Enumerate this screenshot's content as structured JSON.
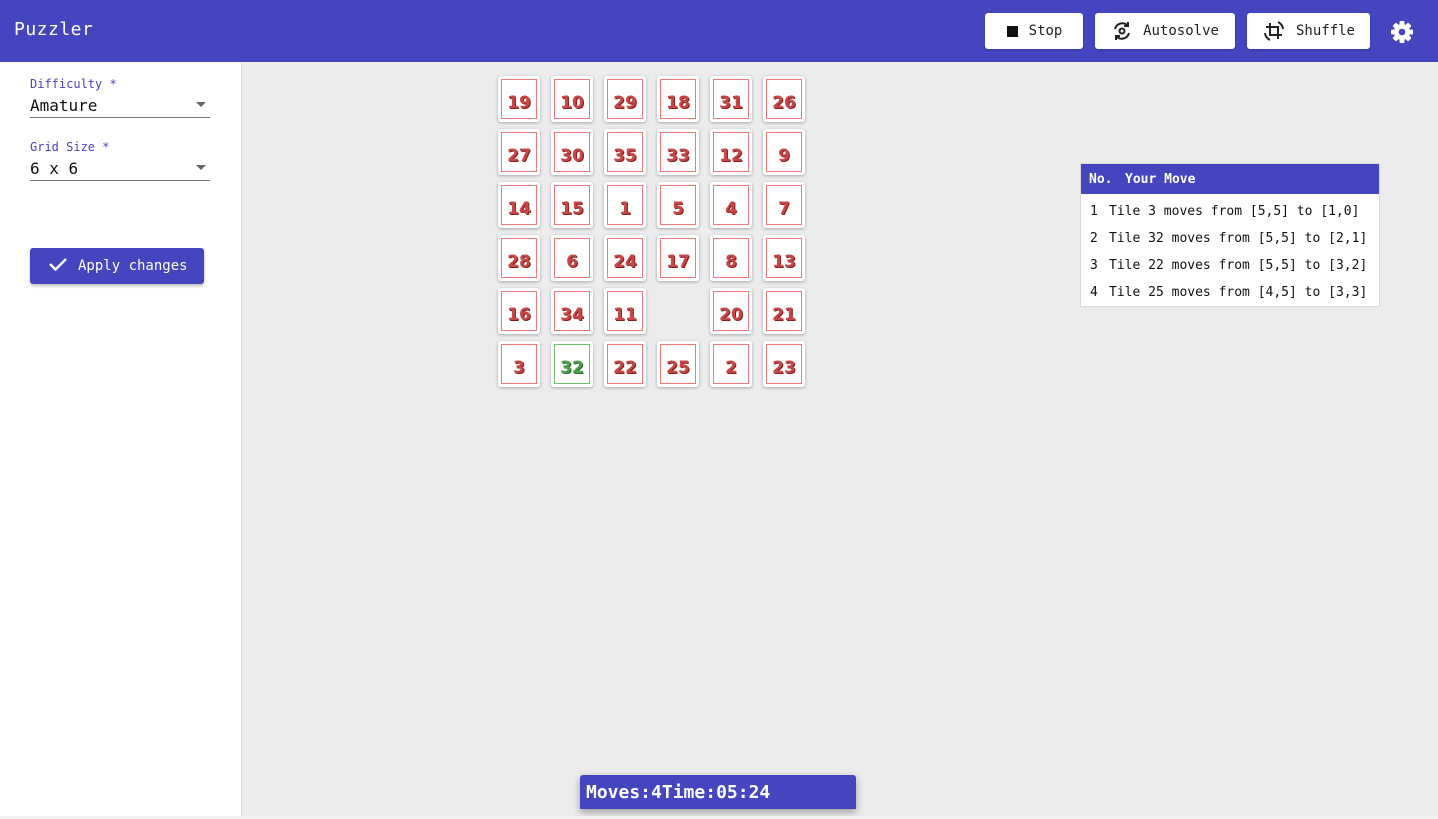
{
  "app": {
    "title": "Puzzler"
  },
  "toolbar": {
    "stop_label": "Stop",
    "autosolve_label": "Autosolve",
    "shuffle_label": "Shuffle"
  },
  "sidebar": {
    "difficulty": {
      "label": "Difficulty *",
      "value": "Amature"
    },
    "grid_size": {
      "label": "Grid Size *",
      "value": "6 x 6"
    },
    "apply_label": "Apply changes"
  },
  "board": {
    "rows": 6,
    "cols": 6,
    "empty_cell": [
      4,
      3
    ],
    "tiles": [
      [
        "19",
        "10",
        "29",
        "18",
        "31",
        "26"
      ],
      [
        "27",
        "30",
        "35",
        "33",
        "12",
        "9"
      ],
      [
        "14",
        "15",
        "1",
        "5",
        "4",
        "7"
      ],
      [
        "28",
        "6",
        "24",
        "17",
        "8",
        "13"
      ],
      [
        "16",
        "34",
        "11",
        "",
        "20",
        "21"
      ],
      [
        "3",
        "32",
        "22",
        "25",
        "2",
        "23"
      ]
    ],
    "correct_tiles": [
      "32"
    ]
  },
  "moves": {
    "header": {
      "no": "No.",
      "move": "Your Move"
    },
    "rows": [
      {
        "no": "1",
        "text": "Tile 3 moves from [5,5] to [1,0]"
      },
      {
        "no": "2",
        "text": "Tile 32 moves from [5,5] to [2,1]"
      },
      {
        "no": "3",
        "text": "Tile 22 moves from [5,5] to [3,2]"
      },
      {
        "no": "4",
        "text": "Tile 25 moves from [4,5] to [3,3]"
      }
    ]
  },
  "status": {
    "moves_label": "Moves:",
    "moves": "4",
    "time_label": "Time:",
    "time": "05:24"
  },
  "colors": {
    "primary": "#4445bf",
    "tile_border": "#f07a7a",
    "tile_text": "#c64747",
    "tile_correct": "#4ba04b"
  },
  "icons": {
    "stop": "stop-icon",
    "autosolve": "autosolve-icon",
    "shuffle": "shuffle-icon",
    "settings": "gear-icon",
    "apply": "check-icon"
  }
}
